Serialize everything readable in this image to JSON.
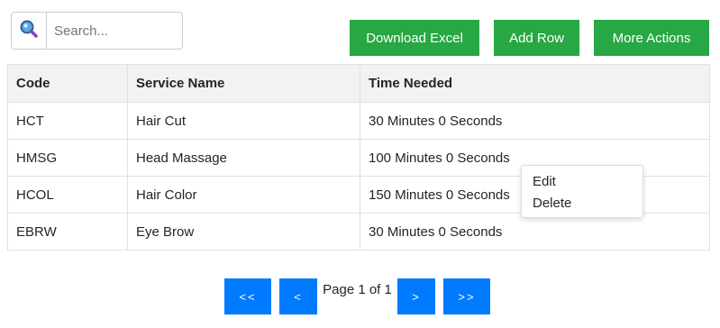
{
  "toolbar": {
    "search": {
      "placeholder": "Search...",
      "value": "",
      "icon": "search-icon"
    },
    "buttons": {
      "download_excel": "Download Excel",
      "add_row": "Add Row",
      "more_actions": "More Actions"
    }
  },
  "table": {
    "headers": [
      "Code",
      "Service Name",
      "Time Needed"
    ],
    "rows": [
      {
        "code": "HCT",
        "service": "Hair Cut",
        "time": "30 Minutes 0 Seconds"
      },
      {
        "code": "HMSG",
        "service": "Head Massage",
        "time": "100 Minutes 0 Seconds"
      },
      {
        "code": "HCOL",
        "service": "Hair Color",
        "time": "150 Minutes 0 Seconds"
      },
      {
        "code": "EBRW",
        "service": "Eye Brow",
        "time": "30 Minutes 0 Seconds"
      }
    ]
  },
  "context_menu": {
    "items": [
      "Edit",
      "Delete"
    ]
  },
  "pagination": {
    "first": "<<",
    "prev": "<",
    "info": "Page 1 of 1",
    "next": ">",
    "last": ">>"
  },
  "colors": {
    "success": "#28a745",
    "primary": "#007bff",
    "header_bg": "#f2f2f2",
    "border": "#dee2e6"
  }
}
